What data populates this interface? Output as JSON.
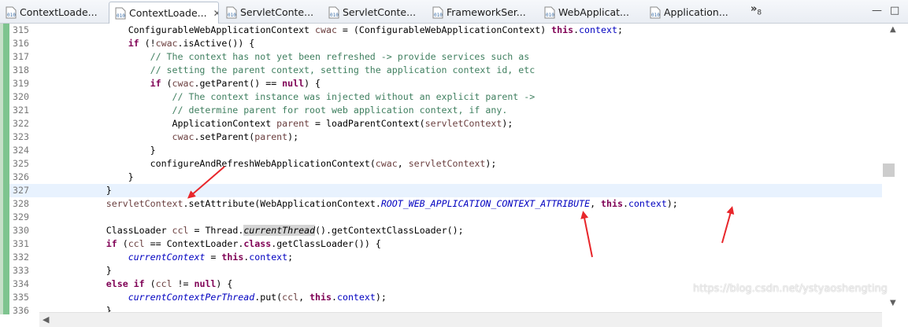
{
  "tabs": [
    {
      "label": "ContextLoade...",
      "active": false
    },
    {
      "label": "ContextLoade...",
      "active": true,
      "close": "✕"
    },
    {
      "label": "ServletConte...",
      "active": false
    },
    {
      "label": "ServletConte...",
      "active": false
    },
    {
      "label": "FrameworkSer...",
      "active": false
    },
    {
      "label": "WebApplicat...",
      "active": false
    },
    {
      "label": "Application...",
      "active": false
    }
  ],
  "overflow": {
    "symbol": "»",
    "count": "8"
  },
  "window_buttons": {
    "minimize": "—",
    "maximize": "□"
  },
  "editor": {
    "line_numbers": [
      "315",
      "316",
      "317",
      "318",
      "319",
      "320",
      "321",
      "322",
      "323",
      "324",
      "325",
      "326",
      "327",
      "328",
      "329",
      "330",
      "331",
      "332",
      "333",
      "334",
      "335",
      "336"
    ],
    "current_line": "327",
    "comments": {
      "l317": "// The context has not yet been refreshed -> provide services such as",
      "l318": "// setting the parent context, setting the application context id, etc",
      "l320": "// The context instance was injected without an explicit parent ->",
      "l321": "// determine parent for root web application context, if any."
    },
    "tokens": {
      "ConfigurableWebApplicationContext": "ConfigurableWebApplicationContext",
      "cwac": "cwac",
      "this": "this",
      "context": "context",
      "if": "if",
      "null": "null",
      "isActive": "isActive",
      "getParent": "getParent",
      "ApplicationContext": "ApplicationContext",
      "parent": "parent",
      "loadParentContext": "loadParentContext",
      "servletContext": "servletContext",
      "setParent": "setParent",
      "configureAndRefresh": "configureAndRefreshWebApplicationContext",
      "setAttribute": "setAttribute",
      "WebApplicationContext": "WebApplicationContext",
      "ROOT_ATTR": "ROOT_WEB_APPLICATION_CONTEXT_ATTRIBUTE",
      "ClassLoader": "ClassLoader",
      "ccl": "ccl",
      "Thread": "Thread",
      "currentThread": "currentThread",
      "getContextClassLoader": "getContextClassLoader",
      "ContextLoader": "ContextLoader",
      "class": "class",
      "getClassLoader": "getClassLoader",
      "currentContext": "currentContext",
      "else": "else",
      "currentContextPerThread": "currentContextPerThread",
      "put": "put"
    }
  },
  "watermark": "https://blog.csdn.net/ystyaoshengting",
  "colors": {
    "keyword": "#7f0055",
    "comment": "#3f7f5f",
    "field": "#0000c0",
    "annotation_arrow": "#e8262b",
    "current_line": "#e8f2fe"
  },
  "icons": {
    "tab_file": "java-class-file-icon",
    "close": "close-icon",
    "overflow": "chevron-double-right-icon",
    "scroll": "scroll-arrow-icon"
  }
}
